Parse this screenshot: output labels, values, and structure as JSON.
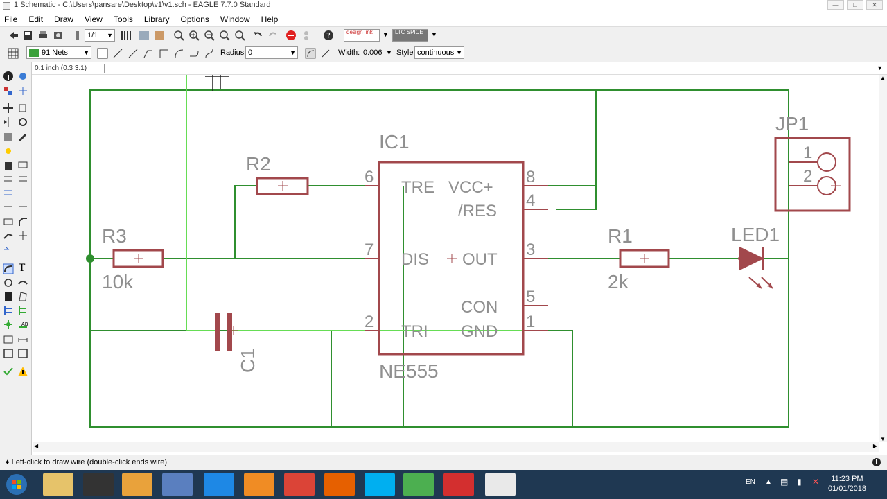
{
  "window": {
    "title": "1 Schematic - C:\\Users\\pansare\\Desktop\\v1\\v1.sch - EAGLE 7.7.0 Standard"
  },
  "menu": [
    "File",
    "Edit",
    "Draw",
    "View",
    "Tools",
    "Library",
    "Options",
    "Window",
    "Help"
  ],
  "toolbar": {
    "sheet_select": "1/1",
    "designlink_label": "design link",
    "ltspice_label": "LTC SPICE"
  },
  "params": {
    "layer": "91 Nets",
    "layer_color": "#3aa03a",
    "radius_label": "Radius:",
    "radius_value": "0",
    "width_label": "Width:",
    "width_value": "0.006",
    "style_label": "Style:",
    "style_value": "continuous"
  },
  "coord": "0.1 inch (0.3 3.1)",
  "status": "Left-click to draw wire (double-click ends wire)",
  "clock": {
    "time": "11:23 PM",
    "date": "01/01/2018"
  },
  "lang": "EN",
  "colors": {
    "net": "#2f8f2f",
    "net_active": "#66dd55",
    "symbol": "#a2484c",
    "label": "#8f8f8f",
    "taskbar": "#1f3852"
  },
  "schematic": {
    "ic": {
      "name": "IC1",
      "value": "NE555",
      "pins_left": [
        {
          "num": "6",
          "name": "TRE"
        },
        {
          "num": "7",
          "name": "DIS"
        },
        {
          "num": "2",
          "name": "TRI"
        }
      ],
      "pins_right": [
        {
          "num": "8",
          "name": "VCC+"
        },
        {
          "num": "4",
          "name": "/RES"
        },
        {
          "num": "3",
          "name": "OUT"
        },
        {
          "num": "5",
          "name": "CON"
        },
        {
          "num": "1",
          "name": "GND"
        }
      ]
    },
    "r1": {
      "name": "R1",
      "value": "2k"
    },
    "r2": {
      "name": "R2"
    },
    "r3": {
      "name": "R3",
      "value": "10k"
    },
    "c1": {
      "name": "C1"
    },
    "led": {
      "name": "LED1"
    },
    "jp": {
      "name": "JP1",
      "pins": [
        "1",
        "2"
      ]
    }
  }
}
